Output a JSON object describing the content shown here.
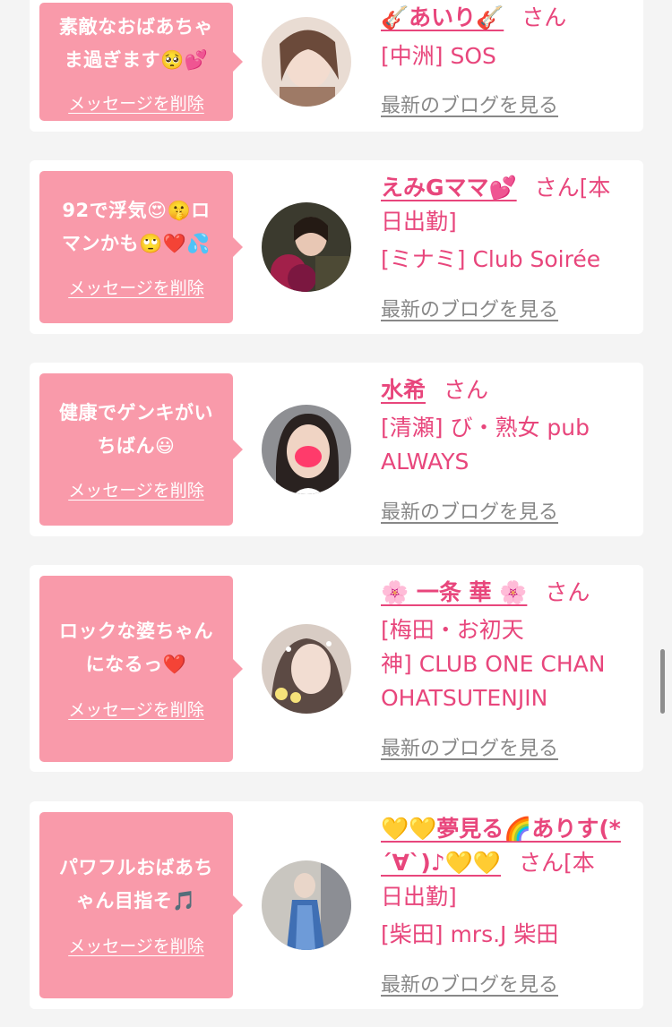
{
  "link_labels": {
    "delete_message": "メッセージを削除",
    "latest_blog": "最新のブログを見る",
    "san": "さん"
  },
  "colors": {
    "bubble": "#f99aaa",
    "accent_text": "#e8467c",
    "link_gray": "#888888",
    "background": "#f4f4f4"
  },
  "cards": [
    {
      "message_lines": [
        "素敵なおばあちゃ",
        "ま過ぎます🥺💕"
      ],
      "name": "🎸あいり🎸",
      "name_suffix": "",
      "shop_lines": [
        "[中洲] SOS"
      ]
    },
    {
      "message_lines": [
        "92で浮気😍🤫ロ",
        "マンかも🙄❤️💦"
      ],
      "name": "えみGママ💕",
      "name_suffix": "[本",
      "name_suffix_line2": "日出勤]",
      "shop_lines": [
        "[ミナミ] Club Soirée"
      ]
    },
    {
      "message_lines": [
        "健康でゲンキがい",
        "ちばん😃"
      ],
      "name": "水希",
      "name_suffix": "",
      "shop_lines": [
        "[清瀬] び・熟女 pub",
        "ALWAYS"
      ]
    },
    {
      "message_lines": [
        "ロックな婆ちゃん",
        "になるっ❤️"
      ],
      "name": "🌸 一条 華 🌸",
      "name_suffix": "",
      "shop_lines": [
        "[梅田・お初天",
        "神] CLUB ONE CHAN",
        "OHATSUTENJIN"
      ]
    },
    {
      "message_lines": [
        "パワフルおばあち",
        "ゃん目指そ🎵"
      ],
      "name_line1": "💛💛夢見る🌈ありす(*",
      "name_line2": "´∀`)♪💛💛",
      "name_suffix": "[本",
      "name_suffix_line2": "日出勤]",
      "shop_lines": [
        "[柴田] mrs.J 柴田"
      ]
    }
  ]
}
